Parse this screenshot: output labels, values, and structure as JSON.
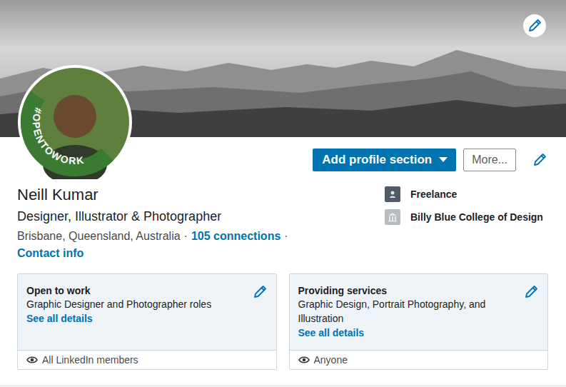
{
  "profile": {
    "badge": "#OPENTOWORK",
    "name": "Neill Kumar",
    "headline": "Designer, Illustrator & Photographer",
    "location": "Brisbane, Queensland, Australia",
    "separator": "·",
    "connections": "105 connections",
    "separator_end": "·",
    "contact_info": "Contact info"
  },
  "actions": {
    "add_section": "Add profile section",
    "more": "More..."
  },
  "experience": [
    {
      "label": "Freelance",
      "kind": "company"
    },
    {
      "label": "Billy Blue College of Design",
      "kind": "school"
    }
  ],
  "cards": [
    {
      "title": "Open to work",
      "description": "Graphic Designer and Photographer roles",
      "link": "See all details",
      "visibility": "All LinkedIn members"
    },
    {
      "title": "Providing services",
      "description": "Graphic Design, Portrait Photography, and Illustration",
      "link": "See all details",
      "visibility": "Anyone"
    }
  ]
}
